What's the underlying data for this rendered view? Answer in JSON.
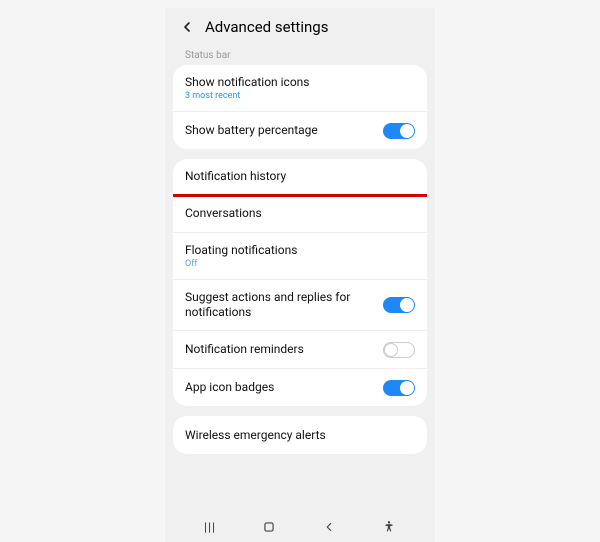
{
  "header": {
    "title": "Advanced settings"
  },
  "section_label": "Status bar",
  "status_bar_card": {
    "show_icons": {
      "title": "Show notification icons",
      "sub": "3 most recent"
    },
    "battery": {
      "title": "Show battery percentage",
      "on": true
    }
  },
  "main_card": {
    "notification_history": {
      "title": "Notification history"
    },
    "conversations": {
      "title": "Conversations"
    },
    "floating": {
      "title": "Floating notifications",
      "sub": "Off"
    },
    "suggest": {
      "title": "Suggest actions and replies for notifications",
      "on": true
    },
    "reminders": {
      "title": "Notification reminders",
      "on": false
    },
    "badges": {
      "title": "App icon badges",
      "on": true
    }
  },
  "alerts_card": {
    "wireless": {
      "title": "Wireless emergency alerts"
    }
  }
}
